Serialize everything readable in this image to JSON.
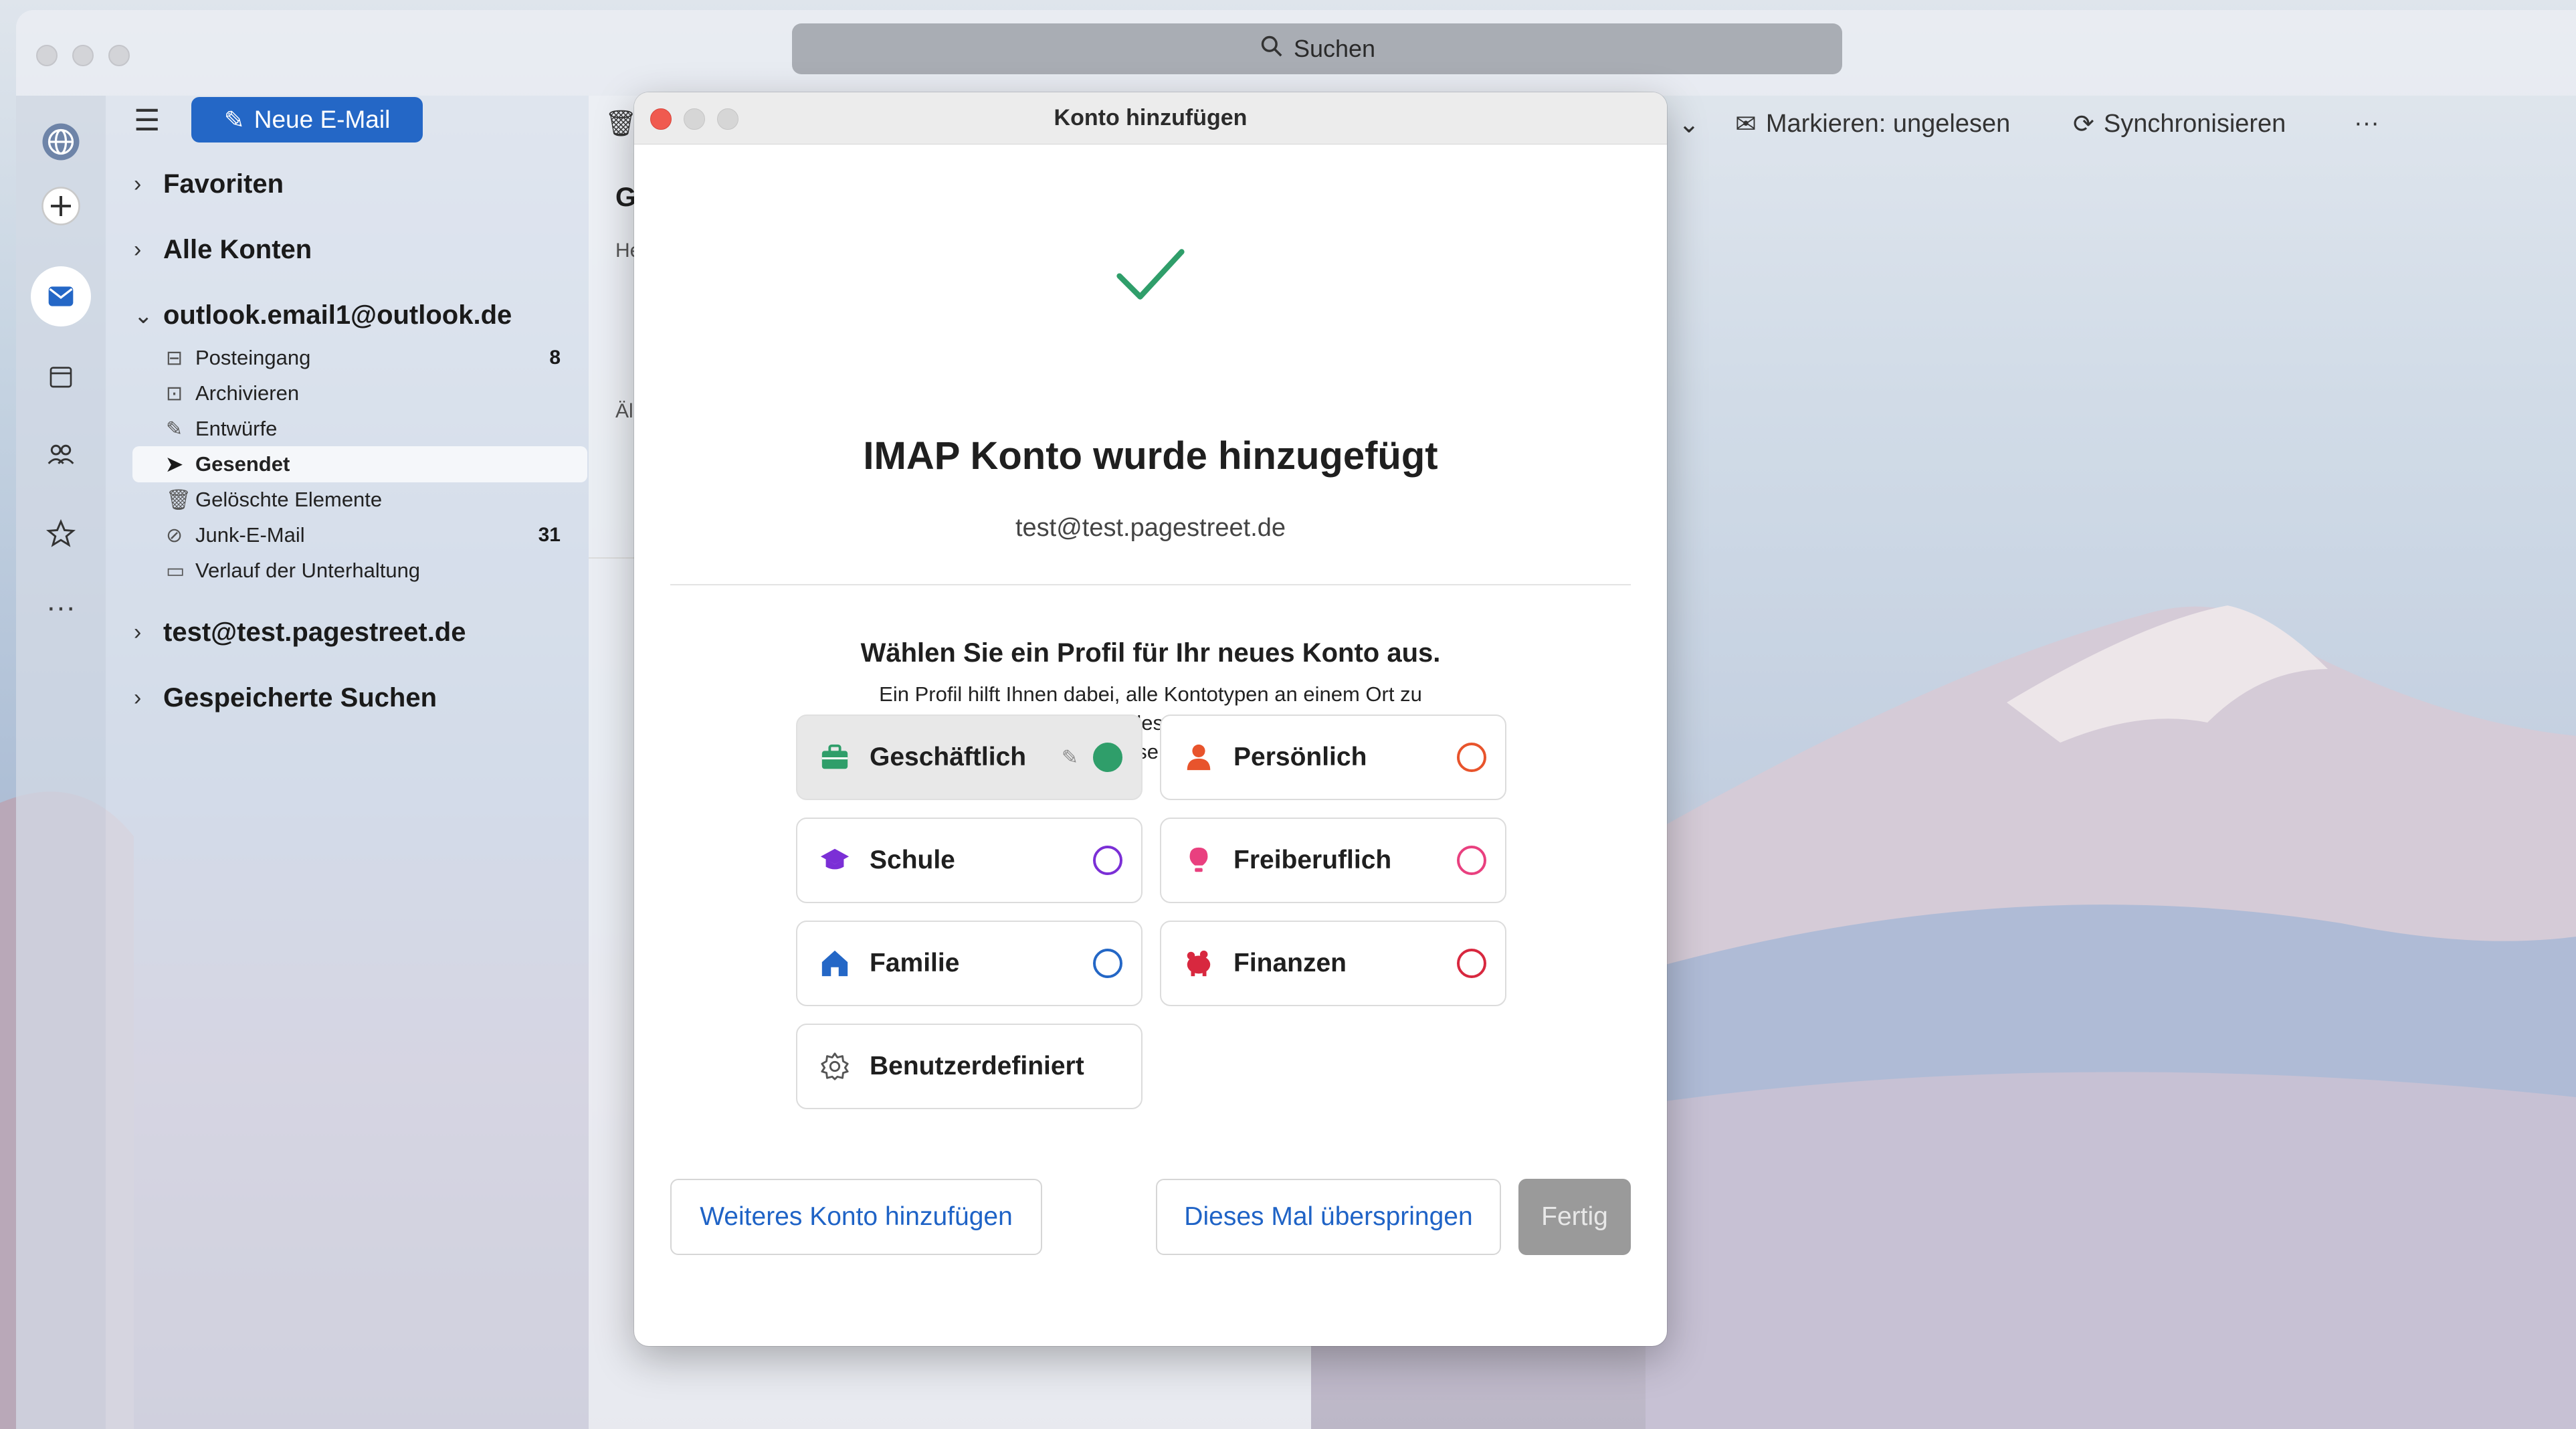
{
  "search": {
    "label": "Suchen"
  },
  "toolbar": {
    "new_mail": "Neue E-Mail",
    "mark_unread": "Markieren: ungelesen",
    "sync": "Synchronisieren",
    "more": "···"
  },
  "sidebar": {
    "favorites": "Favoriten",
    "all_accounts": "Alle Konten",
    "account": "outlook.email1@outlook.de",
    "folders": [
      {
        "label": "Posteingang",
        "count": "8"
      },
      {
        "label": "Archivieren",
        "count": ""
      },
      {
        "label": "Entwürfe",
        "count": ""
      },
      {
        "label": "Gesendet",
        "count": ""
      },
      {
        "label": "Gelöschte Elemente",
        "count": ""
      },
      {
        "label": "Junk-E-Mail",
        "count": "31"
      },
      {
        "label": "Verlauf der Unterhaltung",
        "count": ""
      }
    ],
    "second_account": "test@test.pagestreet.de",
    "saved_searches": "Gespeicherte Suchen"
  },
  "list_pane": {
    "header_fragment": "G",
    "subheader_fragment": "He",
    "older_fragment": "Äl"
  },
  "dialog": {
    "title": "Konto hinzufügen",
    "success_title": "IMAP Konto wurde hinzugefügt",
    "success_email": "test@test.pagestreet.de",
    "profile_title": "Wählen Sie ein Profil für Ihr neues Konto aus.",
    "profile_desc_line1": "Ein Profil hilft Ihnen dabei, alle Kontotypen an einem Ort zu",
    "profile_desc_line2": "organisieren. Sie können für jedes Profil unterschiedliche Designs",
    "profile_desc_line3": "und Benachrichtigungseinstellungen festlegen.",
    "profiles": [
      {
        "label": "Geschäftlich",
        "icon": "briefcase-icon",
        "color": "#2f9e6a",
        "selected": true
      },
      {
        "label": "Persönlich",
        "icon": "person-icon",
        "color": "#e8542c",
        "selected": false
      },
      {
        "label": "Schule",
        "icon": "graduation-cap-icon",
        "color": "#7b2fd6",
        "selected": false
      },
      {
        "label": "Freiberuflich",
        "icon": "lightbulb-icon",
        "color": "#e9407f",
        "selected": false
      },
      {
        "label": "Familie",
        "icon": "house-icon",
        "color": "#2467c6",
        "selected": false
      },
      {
        "label": "Finanzen",
        "icon": "piggy-bank-icon",
        "color": "#d8283f",
        "selected": false
      },
      {
        "label": "Benutzerdefiniert",
        "icon": "gear-icon",
        "color": "#555555",
        "selected": false
      }
    ],
    "buttons": {
      "add_another": "Weiteres Konto hinzufügen",
      "skip": "Dieses Mal überspringen",
      "done": "Fertig"
    }
  },
  "colors": {
    "accent": "#2467c6",
    "success": "#2f9e6a",
    "close": "#f05a4f"
  }
}
